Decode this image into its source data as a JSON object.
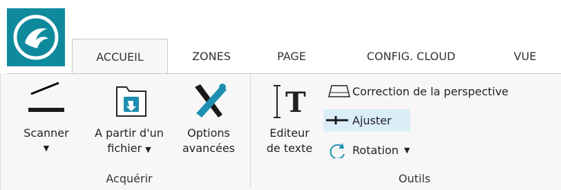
{
  "app": {
    "logo": "app-logo-icon"
  },
  "tabs": [
    {
      "label": "ACCUEIL",
      "active": true
    },
    {
      "label": "ZONES"
    },
    {
      "label": "PAGE"
    },
    {
      "label": "CONFIG. CLOUD"
    },
    {
      "label": "VUE"
    }
  ],
  "ribbon": {
    "acquerir": {
      "label": "Acquérir",
      "scanner": {
        "line1": "Scanner",
        "icon": "scanner-icon"
      },
      "from_file": {
        "line1": "A partir d'un",
        "line2": "fichier",
        "icon": "folder-import-icon"
      },
      "options": {
        "line1": "Options",
        "line2": "avancées",
        "icon": "tools-icon"
      }
    },
    "outils": {
      "label": "Outils",
      "text_editor": {
        "line1": "Editeur",
        "line2": "de texte",
        "icon": "text-editor-icon"
      },
      "perspective": {
        "label": "Correction de la perspective",
        "icon": "perspective-icon"
      },
      "ajuster": {
        "label": "Ajuster",
        "icon": "straighten-icon"
      },
      "rotation": {
        "label": "Rotation",
        "icon": "rotate-icon"
      }
    }
  },
  "colors": {
    "brand": "#0f8a9d",
    "highlight": "#dbeef8",
    "ribbon_bg": "#f7f7f7"
  }
}
